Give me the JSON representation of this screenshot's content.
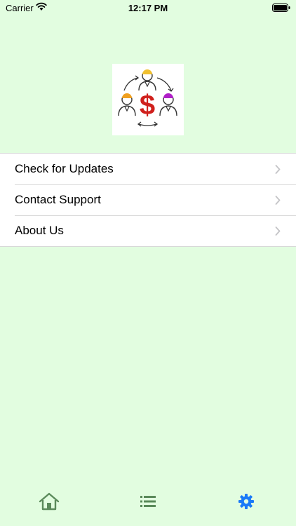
{
  "status_bar": {
    "carrier": "Carrier",
    "time": "12:17 PM"
  },
  "menu": {
    "items": [
      {
        "label": "Check for Updates"
      },
      {
        "label": "Contact Support"
      },
      {
        "label": "About Us"
      }
    ]
  },
  "tab_bar": {
    "tabs": [
      {
        "icon": "home-icon",
        "selected": false
      },
      {
        "icon": "list-icon",
        "selected": false
      },
      {
        "icon": "gear-icon",
        "selected": true
      }
    ],
    "active_color": "#1a7af8",
    "inactive_color": "#5a8a5a"
  },
  "colors": {
    "background": "#e2fde0",
    "logo_dollar": "#d0201c",
    "logo_person_orange": "#f0a020",
    "logo_person_purple": "#b020c8"
  }
}
